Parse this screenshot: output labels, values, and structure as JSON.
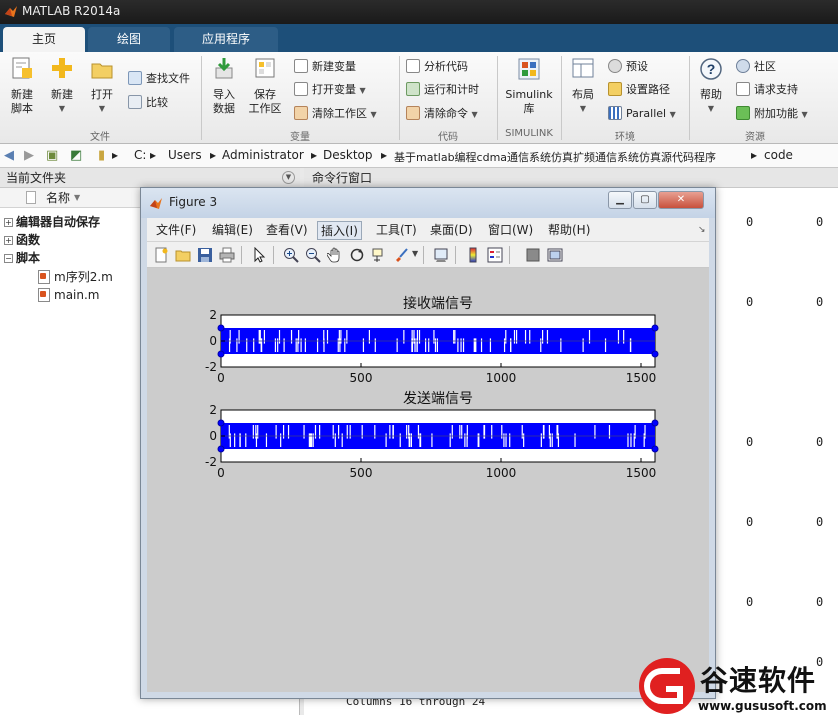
{
  "app": {
    "title": "MATLAB R2014a"
  },
  "tabs": [
    {
      "label": "主页",
      "active": true
    },
    {
      "label": "绘图",
      "active": false
    },
    {
      "label": "应用程序",
      "active": false
    }
  ],
  "ribbon": {
    "file_group": {
      "label": "文件",
      "new_script": "新建\n脚本",
      "new": "新建",
      "open": "打开",
      "find_files": "查找文件",
      "compare": "比较"
    },
    "variable_group": {
      "label": "变量",
      "import_data": "导入\n数据",
      "save_workspace": "保存\n工作区",
      "new_variable": "新建变量",
      "open_variable": "打开变量",
      "clear_workspace": "清除工作区"
    },
    "code_group": {
      "label": "代码",
      "analyze_code": "分析代码",
      "run_and_time": "运行和计时",
      "clear_commands": "清除命令"
    },
    "simulink_group": {
      "label": "SIMULINK",
      "simulink_library": "Simulink\n库"
    },
    "environment_group": {
      "label": "环境",
      "layout": "布局",
      "preferences": "预设",
      "set_path": "设置路径",
      "parallel": "Parallel"
    },
    "resources_group": {
      "label": "资源",
      "help": "帮助",
      "community": "社区",
      "request_support": "请求支持",
      "add_ons": "附加功能"
    }
  },
  "address_bar": {
    "path": [
      "C:",
      "Users",
      "Administrator",
      "Desktop",
      "基于matlab编程cdma通信系统仿真扩频通信系统仿真源代码程序",
      "code"
    ]
  },
  "current_folder": {
    "title": "当前文件夹",
    "column_name": "名称",
    "items": [
      {
        "label": "编辑器自动保存",
        "type": "folder"
      },
      {
        "label": "函数",
        "type": "folder"
      },
      {
        "label": "脚本",
        "type": "folder"
      },
      {
        "label": "m序列2.m",
        "type": "file"
      },
      {
        "label": "main.m",
        "type": "file"
      }
    ]
  },
  "command_window": {
    "title": "命令行窗口",
    "values": [
      "0",
      "0",
      "0",
      "0",
      "0",
      "0",
      "0",
      "0",
      "0",
      "0"
    ],
    "columns_text": "Columns 16 through 24",
    "trailing_value": "0"
  },
  "figure": {
    "title": "Figure 3",
    "menu": [
      {
        "label": "文件(F)"
      },
      {
        "label": "编辑(E)"
      },
      {
        "label": "查看(V)"
      },
      {
        "label": "插入(I)",
        "selected": true
      },
      {
        "label": "工具(T)"
      },
      {
        "label": "桌面(D)"
      },
      {
        "label": "窗口(W)"
      },
      {
        "label": "帮助(H)"
      }
    ],
    "toolbar_icons": [
      "new-figure-icon",
      "open-icon",
      "save-icon",
      "print-icon",
      "pointer-icon",
      "zoom-in-icon",
      "zoom-out-icon",
      "pan-icon",
      "rotate-icon",
      "data-cursor-icon",
      "brush-icon",
      "link-plot-icon",
      "colorbar-icon",
      "legend-icon",
      "hide-plot-tools-icon",
      "show-plot-tools-icon"
    ]
  },
  "chart_data": [
    {
      "type": "line",
      "title": "接收端信号",
      "xlabel": "",
      "ylabel": "",
      "xlim": [
        0,
        1550
      ],
      "ylim": [
        -2,
        2
      ],
      "xticks": [
        "0",
        "500",
        "1000",
        "1500"
      ],
      "yticks": [
        "2",
        "0",
        "-2"
      ],
      "series": [
        {
          "values": [
            1,
            -1
          ],
          "style": "dense bipolar pulses between -1 and 1 with circle markers",
          "color": "#0000ff"
        }
      ],
      "grid": false
    },
    {
      "type": "line",
      "title": "发送端信号",
      "xlabel": "",
      "ylabel": "",
      "xlim": [
        0,
        1550
      ],
      "ylim": [
        -2,
        2
      ],
      "xticks": [
        "0",
        "500",
        "1000",
        "1500"
      ],
      "yticks": [
        "2",
        "0",
        "-2"
      ],
      "series": [
        {
          "values": [
            1,
            -1
          ],
          "style": "dense bipolar pulses between -1 and 1 with circle markers",
          "color": "#0000ff"
        }
      ],
      "grid": false
    }
  ],
  "watermark": {
    "text": "谷速软件",
    "url": "www.gususoft.com",
    "color": "#e02020"
  }
}
